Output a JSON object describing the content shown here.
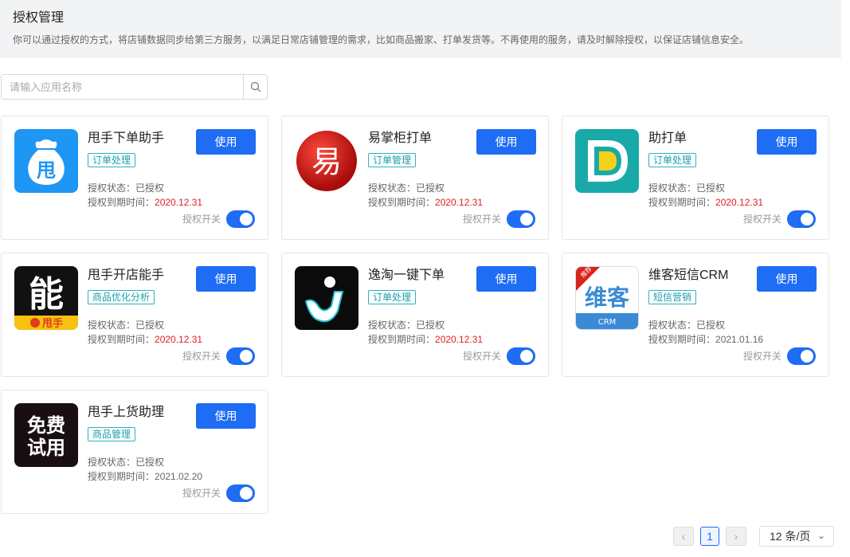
{
  "header": {
    "title": "授权管理",
    "description": "你可以通过授权的方式，将店铺数据同步给第三方服务，以满足日常店铺管理的需求，比如商品搬家、打单发货等。不再使用的服务，请及时解除授权，以保证店铺信息安全。"
  },
  "search": {
    "placeholder": "请输入应用名称"
  },
  "labels": {
    "use": "使用",
    "status": "授权状态：已授权",
    "expiry_prefix": "授权到期时间：",
    "switch": "授权开关"
  },
  "apps": [
    {
      "name": "甩手下单助手",
      "tag": "订单处理",
      "expiry": "2020.12.31",
      "enabled": true,
      "logo_text": "甩"
    },
    {
      "name": "易掌柜打单",
      "tag": "订单管理",
      "expiry": "2020.12.31",
      "enabled": true,
      "logo_text": "易"
    },
    {
      "name": "助打单",
      "tag": "订单处理",
      "expiry": "2020.12.31",
      "enabled": true,
      "logo_text": "D"
    },
    {
      "name": "甩手开店能手",
      "tag": "商品优化分析",
      "expiry": "2020.12.31",
      "enabled": true,
      "logo_text": "能",
      "logo_sub": "甩手"
    },
    {
      "name": "逸淘一键下单",
      "tag": "订单处理",
      "expiry": "2020.12.31",
      "enabled": true,
      "logo_text": "j"
    },
    {
      "name": "维客短信CRM",
      "tag": "短信营销",
      "expiry": "2021.01.16",
      "enabled": true,
      "logo_text": "维客",
      "logo_sub": "CRM",
      "logo_badge": "推荐"
    },
    {
      "name": "甩手上货助理",
      "tag": "商品管理",
      "expiry": "2021.02.20",
      "enabled": true,
      "logo_text": "免费试用"
    }
  ],
  "pagination": {
    "current": "1",
    "page_size": "12 条/页"
  },
  "colors": {
    "primary": "#1f6cf5",
    "expired_red": "#e02020",
    "tag": "#1a9ea8"
  }
}
